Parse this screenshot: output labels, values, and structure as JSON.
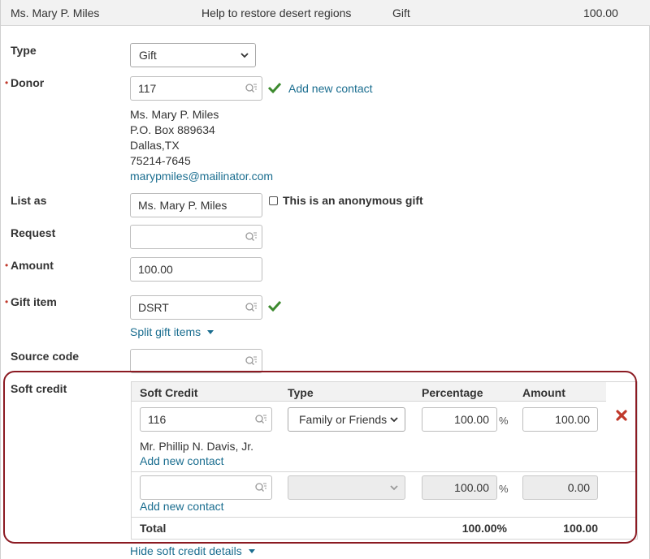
{
  "summary": {
    "donor": "Ms. Mary P. Miles",
    "description": "Help to restore desert regions",
    "type": "Gift",
    "amount": "100.00"
  },
  "form": {
    "type_label": "Type",
    "type_value": "Gift",
    "donor_label": "Donor",
    "donor_value": "117",
    "add_new_contact": "Add new contact",
    "donor_address": {
      "name": "Ms. Mary P. Miles",
      "street": "P.O. Box 889634",
      "city": "Dallas,TX",
      "zip": "75214-7645",
      "email": "marypmiles@mailinator.com"
    },
    "list_as_label": "List as",
    "list_as_value": "Ms. Mary P. Miles",
    "anonymous_label": "This is an anonymous gift",
    "request_label": "Request",
    "request_value": "",
    "amount_label": "Amount",
    "amount_value": "100.00",
    "gift_item_label": "Gift item",
    "gift_item_value": "DSRT",
    "split_gift_items": "Split gift items",
    "source_code_label": "Source code",
    "source_code_value": "",
    "soft_credit_label": "Soft credit",
    "hide_soft_credit": "Hide soft credit details"
  },
  "soft_credit": {
    "columns": [
      "Soft Credit",
      "Type",
      "Percentage",
      "Amount"
    ],
    "rows": [
      {
        "contact": "116",
        "type": "Family or Friends",
        "percentage": "100.00",
        "amount": "100.00",
        "contact_name": "Mr. Phillip N. Davis, Jr.",
        "add_new_contact": "Add new contact"
      },
      {
        "contact": "",
        "type": "",
        "percentage": "100.00",
        "amount": "0.00",
        "add_new_contact": "Add new contact"
      }
    ],
    "pct_sign": "%",
    "total_label": "Total",
    "total_percentage": "100.00%",
    "total_amount": "100.00"
  },
  "colors": {
    "link": "#1a6d8f",
    "required": "#c0392b",
    "check": "#3c8a2e",
    "delete": "#c0392b",
    "highlight_outline": "#8b1a22"
  }
}
